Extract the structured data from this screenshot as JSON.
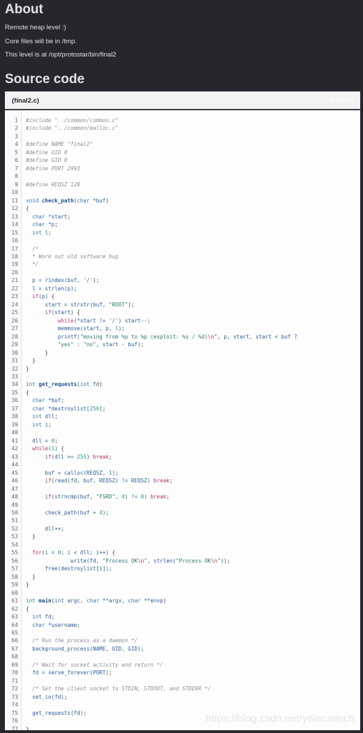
{
  "about": {
    "title": "About",
    "lines": [
      "Remote heap level :)",
      "Core files will be in /tmp.",
      "This level is at /opt/protostar/bin/final2"
    ]
  },
  "source": {
    "title": "Source code",
    "filename": "(final2.c)",
    "download_label": "download",
    "lines": [
      [
        [
          "pp",
          "#include \"../common/common.c\""
        ]
      ],
      [
        [
          "pp",
          "#include \"../common/malloc.c\""
        ]
      ],
      [],
      [
        [
          "pp",
          "#define NAME \"final2\""
        ]
      ],
      [
        [
          "pp",
          "#define UID 0"
        ]
      ],
      [
        [
          "pp",
          "#define GID 0"
        ]
      ],
      [
        [
          "pp",
          "#define PORT 2993"
        ]
      ],
      [],
      [
        [
          "pp",
          "#define REQSZ 128"
        ]
      ],
      [],
      [
        [
          "ty",
          "void "
        ],
        [
          "fn",
          "check_path"
        ],
        [
          "op",
          "("
        ],
        [
          "ty",
          "char "
        ],
        [
          "id",
          "*buf"
        ],
        [
          "op",
          ")"
        ]
      ],
      [
        [
          "op",
          "{"
        ]
      ],
      [
        [
          "ty",
          "  char "
        ],
        [
          "id",
          "*start"
        ],
        [
          "op",
          ";"
        ]
      ],
      [
        [
          "ty",
          "  char "
        ],
        [
          "id",
          "*p"
        ],
        [
          "op",
          ";"
        ]
      ],
      [
        [
          "ty",
          "  int "
        ],
        [
          "id",
          "l"
        ],
        [
          "op",
          ";"
        ]
      ],
      [],
      [
        [
          "cm",
          "  /*"
        ]
      ],
      [
        [
          "cm",
          "  * Work out old software bug"
        ]
      ],
      [
        [
          "cm",
          "  */"
        ]
      ],
      [],
      [
        [
          "id",
          "  p = rindex(buf, "
        ],
        [
          "st",
          "'/'"
        ],
        [
          "op",
          ");"
        ]
      ],
      [
        [
          "id",
          "  l = strlen(p)"
        ],
        [
          "op",
          ";"
        ]
      ],
      [
        [
          "kw",
          "  if"
        ],
        [
          "id",
          "(p) "
        ],
        [
          "op",
          "{"
        ]
      ],
      [
        [
          "id",
          "      start = strstr(buf, "
        ],
        [
          "st",
          "\"ROOT\""
        ],
        [
          "op",
          ");"
        ]
      ],
      [
        [
          "kw",
          "      if"
        ],
        [
          "id",
          "(start) "
        ],
        [
          "op",
          "{"
        ]
      ],
      [
        [
          "kw",
          "          while"
        ],
        [
          "id",
          "(*start != "
        ],
        [
          "st",
          "'/'"
        ],
        [
          "id",
          ") start--"
        ],
        [
          "op",
          ";"
        ]
      ],
      [
        [
          "id",
          "          memmove(start, p, l)"
        ],
        [
          "op",
          ";"
        ]
      ],
      [
        [
          "id",
          "          printf("
        ],
        [
          "st",
          "\"moving from %p to %p (exploit: %s / %d)"
        ],
        [
          "es",
          "\\n"
        ],
        [
          "st",
          "\""
        ],
        [
          "id",
          ", p, start, start < buf ?"
        ]
      ],
      [
        [
          "st",
          "          \"yes\""
        ],
        [
          "id",
          " : "
        ],
        [
          "st",
          "\"no\""
        ],
        [
          "id",
          ", start - buf)"
        ],
        [
          "op",
          ";"
        ]
      ],
      [
        [
          "op",
          "      }"
        ]
      ],
      [
        [
          "op",
          "  }"
        ]
      ],
      [
        [
          "op",
          "}"
        ]
      ],
      [],
      [
        [
          "ty",
          "int "
        ],
        [
          "fn",
          "get_requests"
        ],
        [
          "op",
          "("
        ],
        [
          "ty",
          "int "
        ],
        [
          "id",
          "fd"
        ],
        [
          "op",
          ")"
        ]
      ],
      [
        [
          "op",
          "{"
        ]
      ],
      [
        [
          "ty",
          "  char "
        ],
        [
          "id",
          "*buf"
        ],
        [
          "op",
          ";"
        ]
      ],
      [
        [
          "ty",
          "  char "
        ],
        [
          "id",
          "*destroylist["
        ],
        [
          "nm",
          "256"
        ],
        [
          "id",
          "]"
        ],
        [
          "op",
          ";"
        ]
      ],
      [
        [
          "ty",
          "  int "
        ],
        [
          "id",
          "dll"
        ],
        [
          "op",
          ";"
        ]
      ],
      [
        [
          "ty",
          "  int "
        ],
        [
          "id",
          "i"
        ],
        [
          "op",
          ";"
        ]
      ],
      [],
      [
        [
          "id",
          "  dll = "
        ],
        [
          "nm",
          "0"
        ],
        [
          "op",
          ";"
        ]
      ],
      [
        [
          "kw",
          "  while"
        ],
        [
          "id",
          "("
        ],
        [
          "nm",
          "1"
        ],
        [
          "id",
          ") "
        ],
        [
          "op",
          "{"
        ]
      ],
      [
        [
          "kw",
          "      if"
        ],
        [
          "id",
          "(dll >= "
        ],
        [
          "nm",
          "255"
        ],
        [
          "id",
          ") "
        ],
        [
          "kw",
          "break"
        ],
        [
          "op",
          ";"
        ]
      ],
      [],
      [
        [
          "id",
          "      buf = calloc(REQSZ, "
        ],
        [
          "nm",
          "1"
        ],
        [
          "id",
          ")"
        ],
        [
          "op",
          ";"
        ]
      ],
      [
        [
          "kw",
          "      if"
        ],
        [
          "id",
          "(read(fd, buf, REQSZ) != REQSZ) "
        ],
        [
          "kw",
          "break"
        ],
        [
          "op",
          ";"
        ]
      ],
      [],
      [
        [
          "kw",
          "      if"
        ],
        [
          "id",
          "(strncmp(buf, "
        ],
        [
          "st",
          "\"FSRD\""
        ],
        [
          "id",
          ", "
        ],
        [
          "nm",
          "4"
        ],
        [
          "id",
          ") != "
        ],
        [
          "nm",
          "0"
        ],
        [
          "id",
          ") "
        ],
        [
          "kw",
          "break"
        ],
        [
          "op",
          ";"
        ]
      ],
      [],
      [
        [
          "id",
          "      check_path(buf + "
        ],
        [
          "nm",
          "4"
        ],
        [
          "id",
          ")"
        ],
        [
          "op",
          ";"
        ]
      ],
      [],
      [
        [
          "id",
          "      dll++"
        ],
        [
          "op",
          ";"
        ]
      ],
      [
        [
          "op",
          "  }"
        ]
      ],
      [],
      [
        [
          "kw",
          "  for"
        ],
        [
          "id",
          "(i = "
        ],
        [
          "nm",
          "0"
        ],
        [
          "id",
          "; i < dll; i++) "
        ],
        [
          "op",
          "{"
        ]
      ],
      [
        [
          "id",
          "              write(fd, "
        ],
        [
          "st",
          "\"Process OK"
        ],
        [
          "es",
          "\\n"
        ],
        [
          "st",
          "\""
        ],
        [
          "id",
          ", strlen("
        ],
        [
          "st",
          "\"Process OK"
        ],
        [
          "es",
          "\\n"
        ],
        [
          "st",
          "\""
        ],
        [
          "id",
          "))"
        ],
        [
          "op",
          ";"
        ]
      ],
      [
        [
          "id",
          "      free(destroylist[i])"
        ],
        [
          "op",
          ";"
        ]
      ],
      [
        [
          "op",
          "  }"
        ]
      ],
      [
        [
          "op",
          "}"
        ]
      ],
      [],
      [
        [
          "ty",
          "int "
        ],
        [
          "fn",
          "main"
        ],
        [
          "op",
          "("
        ],
        [
          "ty",
          "int "
        ],
        [
          "id",
          "argc, "
        ],
        [
          "ty",
          "char "
        ],
        [
          "id",
          "**argv, "
        ],
        [
          "ty",
          "char "
        ],
        [
          "id",
          "**envp"
        ],
        [
          "op",
          ")"
        ]
      ],
      [
        [
          "op",
          "{"
        ]
      ],
      [
        [
          "ty",
          "  int "
        ],
        [
          "id",
          "fd"
        ],
        [
          "op",
          ";"
        ]
      ],
      [
        [
          "ty",
          "  char "
        ],
        [
          "id",
          "*username"
        ],
        [
          "op",
          ";"
        ]
      ],
      [],
      [
        [
          "cm",
          "  /* Run the process as a daemon */"
        ]
      ],
      [
        [
          "id",
          "  background_process(NAME, UID, GID)"
        ],
        [
          "op",
          ";"
        ]
      ],
      [],
      [
        [
          "cm",
          "  /* Wait for socket activity and return */"
        ]
      ],
      [
        [
          "id",
          "  fd = serve_forever(PORT)"
        ],
        [
          "op",
          ";"
        ]
      ],
      [],
      [
        [
          "cm",
          "  /* Set the client socket to STDIN, STDOUT, and STDERR */"
        ]
      ],
      [
        [
          "id",
          "  set_io(fd)"
        ],
        [
          "op",
          ";"
        ]
      ],
      [],
      [
        [
          "id",
          "  get_requests(fd)"
        ],
        [
          "op",
          ";"
        ]
      ],
      [],
      [
        [
          "op",
          "}"
        ]
      ]
    ]
  },
  "watermark": "https://blog.csdn.net/yalecaltech"
}
